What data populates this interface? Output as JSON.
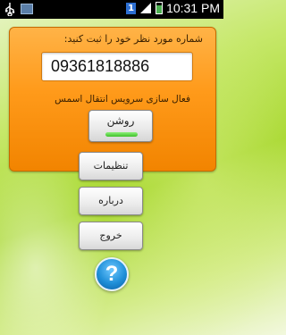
{
  "status_bar": {
    "time": "10:31 PM",
    "notification_badge": "1",
    "icons": [
      "usb-icon",
      "image-icon",
      "notification-badge-icon",
      "signal-icon",
      "battery-icon"
    ]
  },
  "card": {
    "title": "شماره مورد نظر خود را ثبت کنید:",
    "phone_value": "09361818886",
    "service_label": "فعال سازی سرویس انتقال اسمس",
    "toggle_label": "روشن",
    "toggle_state": "on"
  },
  "menu": {
    "settings_label": "تنظیمات",
    "about_label": "درباره",
    "exit_label": "خروج",
    "help_symbol": "?"
  },
  "colors": {
    "card_orange": "#ff9a1a",
    "toggle_green": "#3fc12a",
    "help_blue": "#1f8fd8"
  }
}
